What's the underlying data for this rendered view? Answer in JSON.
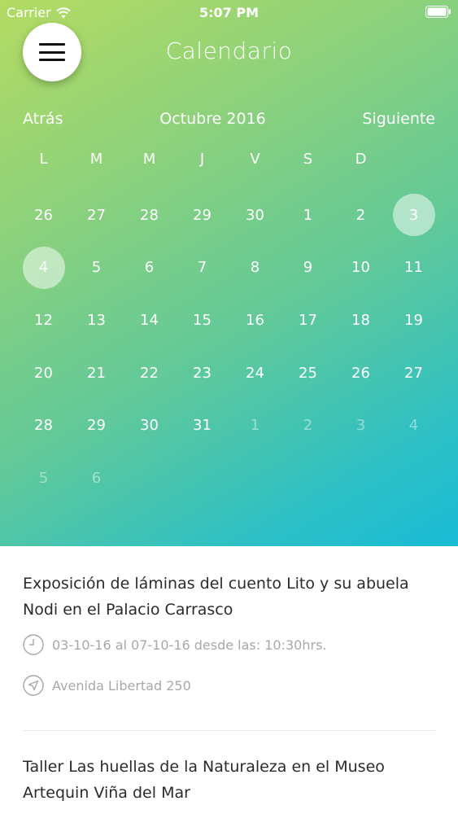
{
  "status_bar": {
    "carrier": "Carrier",
    "time": "5:07 PM"
  },
  "header": {
    "title": "Calendario",
    "prev_label": "Atrás",
    "month_label": "Octubre 2016",
    "next_label": "Siguiente"
  },
  "calendar": {
    "weekdays": [
      "L",
      "M",
      "M",
      "J",
      "V",
      "S",
      "D"
    ],
    "days": [
      {
        "label": "26",
        "other": false,
        "selected": false
      },
      {
        "label": "27",
        "other": false,
        "selected": false
      },
      {
        "label": "28",
        "other": false,
        "selected": false
      },
      {
        "label": "29",
        "other": false,
        "selected": false
      },
      {
        "label": "30",
        "other": false,
        "selected": false
      },
      {
        "label": "1",
        "other": false,
        "selected": false
      },
      {
        "label": "2",
        "other": false,
        "selected": false
      },
      {
        "label": "3",
        "other": false,
        "selected": true
      },
      {
        "label": "4",
        "other": false,
        "selected": true
      },
      {
        "label": "5",
        "other": false,
        "selected": false
      },
      {
        "label": "6",
        "other": false,
        "selected": false
      },
      {
        "label": "7",
        "other": false,
        "selected": false
      },
      {
        "label": "8",
        "other": false,
        "selected": false
      },
      {
        "label": "9",
        "other": false,
        "selected": false
      },
      {
        "label": "10",
        "other": false,
        "selected": false
      },
      {
        "label": "11",
        "other": false,
        "selected": false
      },
      {
        "label": "12",
        "other": false,
        "selected": false
      },
      {
        "label": "13",
        "other": false,
        "selected": false
      },
      {
        "label": "14",
        "other": false,
        "selected": false
      },
      {
        "label": "15",
        "other": false,
        "selected": false
      },
      {
        "label": "16",
        "other": false,
        "selected": false
      },
      {
        "label": "17",
        "other": false,
        "selected": false
      },
      {
        "label": "18",
        "other": false,
        "selected": false
      },
      {
        "label": "19",
        "other": false,
        "selected": false
      },
      {
        "label": "20",
        "other": false,
        "selected": false
      },
      {
        "label": "21",
        "other": false,
        "selected": false
      },
      {
        "label": "22",
        "other": false,
        "selected": false
      },
      {
        "label": "23",
        "other": false,
        "selected": false
      },
      {
        "label": "24",
        "other": false,
        "selected": false
      },
      {
        "label": "25",
        "other": false,
        "selected": false
      },
      {
        "label": "26",
        "other": false,
        "selected": false
      },
      {
        "label": "27",
        "other": false,
        "selected": false
      },
      {
        "label": "28",
        "other": false,
        "selected": false
      },
      {
        "label": "29",
        "other": false,
        "selected": false
      },
      {
        "label": "30",
        "other": false,
        "selected": false
      },
      {
        "label": "31",
        "other": false,
        "selected": false
      },
      {
        "label": "1",
        "other": true,
        "selected": false
      },
      {
        "label": "2",
        "other": true,
        "selected": false
      },
      {
        "label": "3",
        "other": true,
        "selected": false
      },
      {
        "label": "4",
        "other": true,
        "selected": false
      },
      {
        "label": "5",
        "other": true,
        "selected": false
      },
      {
        "label": "6",
        "other": true,
        "selected": false
      }
    ]
  },
  "events": [
    {
      "title": "Exposición de láminas del cuento Lito y su abuela Nodi en el Palacio Carrasco",
      "schedule": "03-10-16 al 07-10-16 desde las: 10:30hrs.",
      "location": "Avenida Libertad 250"
    },
    {
      "title": "Taller Las huellas de la Naturaleza en el Museo Artequin Viña del Mar"
    }
  ],
  "icons": {
    "menu": "hamburger-icon",
    "schedule": "clock-icon",
    "location": "location-arrow-icon"
  },
  "colors": {
    "gradient_start": "#b4db62",
    "gradient_end": "#19bbd6",
    "text_primary": "#2b2b2b",
    "text_secondary": "#a8a8a8"
  }
}
